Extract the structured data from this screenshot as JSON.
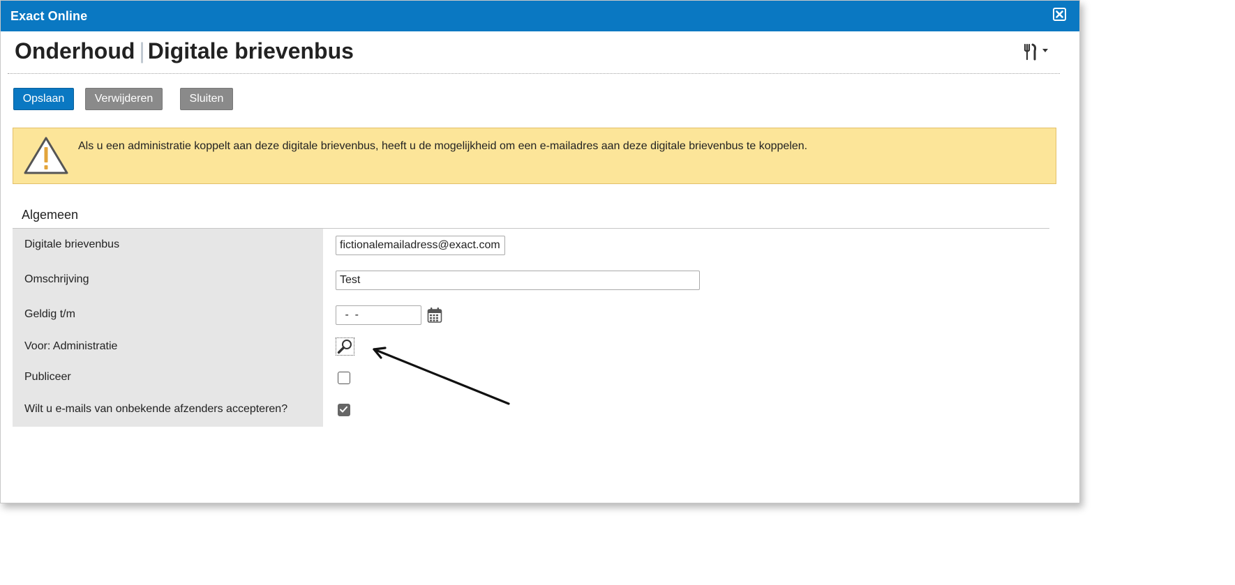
{
  "window": {
    "app_title": "Exact Online"
  },
  "header": {
    "section": "Onderhoud",
    "title": "Digitale brievenbus"
  },
  "toolbar": {
    "save_label": "Opslaan",
    "delete_label": "Verwijderen",
    "close_label": "Sluiten"
  },
  "warning": {
    "text": "Als u een administratie koppelt aan deze digitale brievenbus, heeft u de mogelijkheid om een e-mailadres aan deze digitale brievenbus te koppelen."
  },
  "form": {
    "section_title": "Algemeen",
    "fields": {
      "mailbox": {
        "label": "Digitale brievenbus",
        "value": "fictionalemailadress@exact.com"
      },
      "description": {
        "label": "Omschrijving",
        "value": "Test"
      },
      "valid_until": {
        "label": "Geldig t/m",
        "value": " -  -"
      },
      "for_administration": {
        "label": "Voor: Administratie"
      },
      "publish": {
        "label": "Publiceer",
        "checked": false
      },
      "accept_unknown": {
        "label": "Wilt u e-mails van onbekende afzenders accepteren?",
        "checked": true
      }
    }
  },
  "colors": {
    "brand_blue": "#0a78c2",
    "warning_bg": "#fce599",
    "label_bg": "#e6e6e6",
    "grey_button": "#8a8a8a"
  },
  "icons": {
    "close": "close-icon",
    "tools": "tools-icon",
    "warning": "warning-triangle-icon",
    "calendar": "calendar-icon",
    "lookup": "magnifier-icon"
  }
}
